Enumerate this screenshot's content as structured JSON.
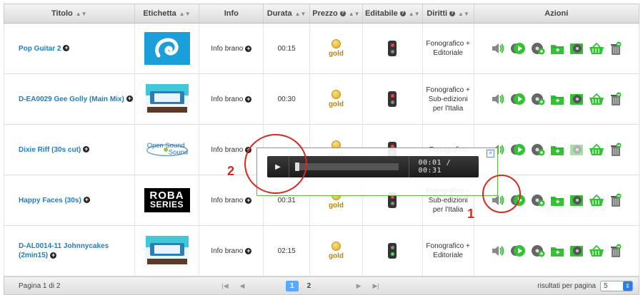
{
  "header": {
    "titolo": "Titolo",
    "etichetta": "Etichetta",
    "info": "Info",
    "durata": "Durata",
    "prezzo": "Prezzo",
    "editabile": "Editabile",
    "diritti": "Diritti",
    "azioni": "Azioni"
  },
  "rows": [
    {
      "title": "Pop Guitar 2",
      "label_logo": "wave-logo",
      "info": "Info brano",
      "duration": "00:15",
      "price": "gold",
      "editable": "red",
      "rights": "Fonografico + Editoriale"
    },
    {
      "title": "D-EA0029 Gee Golly (Main Mix)",
      "label_logo": "diner-logo",
      "info": "Info brano",
      "duration": "00:30",
      "price": "gold",
      "editable": "red",
      "rights": "Fonografico + Sub-edizioni per l'Italia"
    },
    {
      "title": "Dixie Riff (30s cut)",
      "label_logo": "opensound-logo",
      "label_text": "Open Sound",
      "info": "Info brano",
      "duration": "",
      "price": "gold",
      "editable": "red",
      "rights": "Fonografico"
    },
    {
      "title": "Happy Faces (30s)",
      "label_logo": "roba-logo",
      "label_text": "ROBA SERIES",
      "info": "Info brano",
      "duration": "00:31",
      "price": "gold",
      "editable": "red",
      "rights": "Fonografico + Sub-edizioni per l'Italia"
    },
    {
      "title": "D-AL0014-11 Johnnycakes (2min15)",
      "label_logo": "diner-logo",
      "info": "Info brano",
      "duration": "02:15",
      "price": "gold",
      "editable": "green",
      "rights": "Fonografico + Editoriale"
    }
  ],
  "footer": {
    "page_text": "Pagina 1 di 2",
    "pages": [
      "1",
      "2"
    ],
    "current_page": "1",
    "rpp_label": "risultati per pagina",
    "rpp_value": "5"
  },
  "player": {
    "time": "00:01 / 00:31"
  },
  "annotations": [
    "1",
    "2"
  ],
  "colors": {
    "link": "#1a7fc6",
    "accent_green": "#33c233",
    "annotation_red": "#d42a1f"
  }
}
